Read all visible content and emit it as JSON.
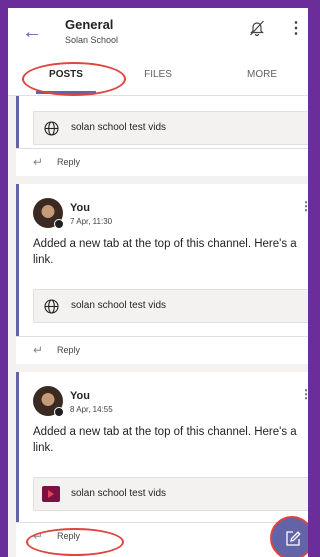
{
  "channel": {
    "title": "General",
    "team": "Solan School"
  },
  "tabs": [
    {
      "label": "POSTS",
      "active": true
    },
    {
      "label": "FILES",
      "active": false
    },
    {
      "label": "MORE",
      "active": false
    }
  ],
  "posts": [
    {
      "link_title": "solan school test vids",
      "reply_label": "Reply"
    },
    {
      "author": "You",
      "time": "7 Apr, 11:30",
      "message": "Added a new tab at the top of this channel. Here's a link.",
      "link_title": "solan school test vids",
      "link_icon": "globe-icon",
      "reply_label": "Reply"
    },
    {
      "author": "You",
      "time": "8 Apr, 14:55",
      "message": "Added a new tab at the top of this channel. Here's a link.",
      "link_title": "solan school test vids",
      "link_icon": "video-thumbnail",
      "reply_label": "Reply"
    }
  ],
  "colors": {
    "accent": "#6264a7",
    "annotation": "#e0443e",
    "frame": "#6b2d9a"
  }
}
